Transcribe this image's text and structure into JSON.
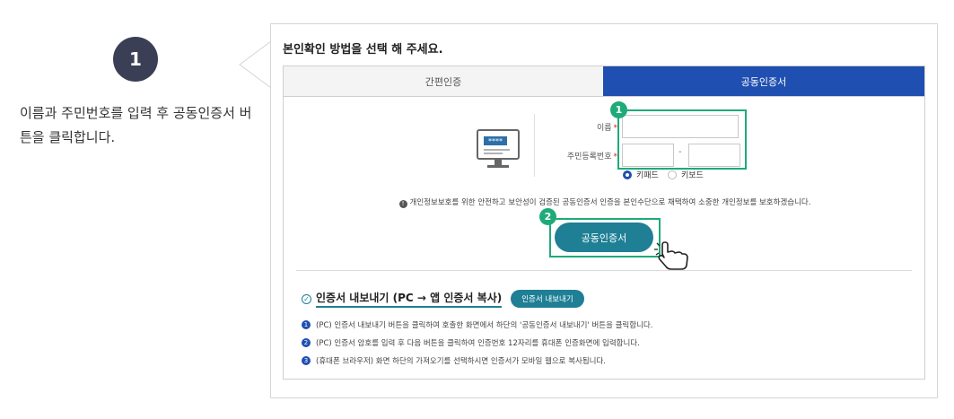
{
  "step": {
    "number": "1",
    "description": "이름과 주민번호를 입력 후 공동인증서 버튼을 클릭합니다."
  },
  "card": {
    "title": "본인확인 방법을 선택 해 주세요.",
    "tabs": [
      {
        "label": "간편인증",
        "active": false
      },
      {
        "label": "공동인증서",
        "active": true
      }
    ],
    "form": {
      "name_label": "이름",
      "rrn_label": "주민등록번호",
      "required_mark": "*",
      "rrn_separator": "-",
      "name_value": "",
      "rrn_front_value": "",
      "rrn_back_value": "",
      "input_modes": [
        {
          "label": "키패드",
          "selected": true
        },
        {
          "label": "키보드",
          "selected": false
        }
      ]
    },
    "annotations": {
      "box1": "1",
      "box2": "2"
    },
    "notice": "개인정보보호를 위한 안전하고 보안성이 검증된 공동인증서 인증을 본인수단으로 채택하여 소중한 개인정보를 보호하겠습니다.",
    "main_button": "공동인증서",
    "monitor_stars": "****",
    "export": {
      "title": "인증서 내보내기 (PC → 앱 인증서 복사)",
      "button": "인증서 내보내기",
      "steps": [
        {
          "num": "1",
          "text": "(PC) 인증서 내보내기 버튼을 클릭하여 호출한 화면에서 하단의 '공동인증서 내보내기' 버튼을 클릭합니다."
        },
        {
          "num": "2",
          "text": "(PC) 인증서 암호를 입력 후 다음 버튼을 클릭하여 인증번호 12자리를 휴대폰 인증화면에 입력합니다."
        },
        {
          "num": "3",
          "text": "(휴대폰 브라우저) 화면 하단의 가져오기를 선택하시면 인증서가 모바일 웹으로 복사됩니다."
        }
      ]
    }
  },
  "colors": {
    "primary": "#1f4fb0",
    "teal": "#1e7f95",
    "green": "#1faa7a",
    "badge": "#3b3f55"
  }
}
